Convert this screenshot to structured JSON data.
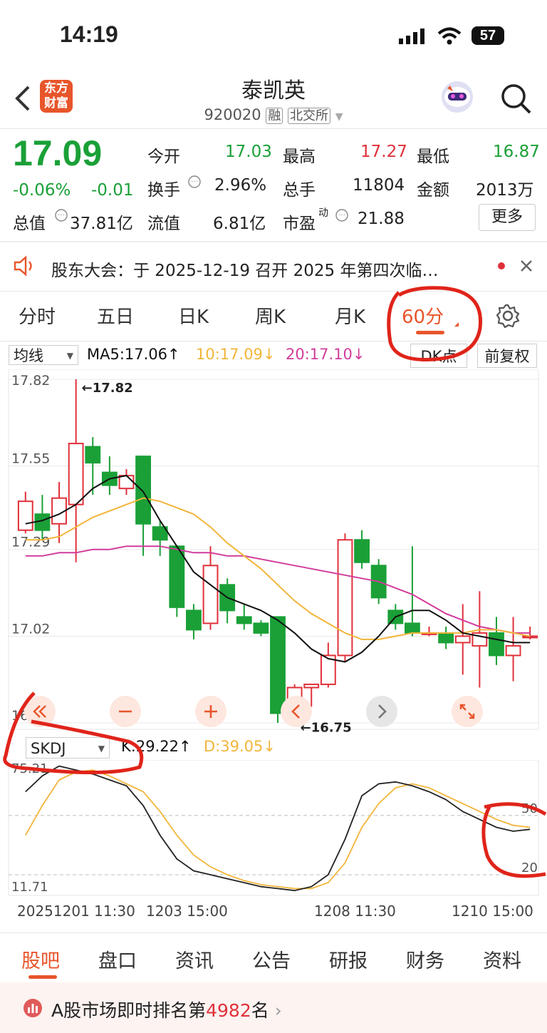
{
  "status_bar": {
    "time": "14:19",
    "battery": "57"
  },
  "header": {
    "back_icon": "chevron-left-icon",
    "logo_text_line1": "东方",
    "logo_text_line2": "财富",
    "title": "泰凯英",
    "code": "920020",
    "tag_margin": "融",
    "tag_exchange": "北交所",
    "search_icon": "search-icon"
  },
  "quote": {
    "price": "17.09",
    "change_pct": "-0.06%",
    "change": "-0.01",
    "market_cap_label": "总值",
    "market_cap": "37.81亿",
    "rows": [
      [
        {
          "label": "今开",
          "value": "17.03",
          "color": "green"
        },
        {
          "label": "最高",
          "value": "17.27",
          "color": "red"
        },
        {
          "label": "最低",
          "value": "16.87",
          "color": "green"
        }
      ],
      [
        {
          "label": "换手",
          "value": "2.96%",
          "color": "black"
        },
        {
          "label": "总手",
          "value": "11804",
          "color": "black"
        },
        {
          "label": "金额",
          "value": "2013万",
          "color": "black"
        }
      ],
      [
        {
          "label": "流值",
          "value": "6.81亿",
          "color": "black"
        },
        {
          "label": "市盈",
          "value": "21.88",
          "color": "black"
        }
      ]
    ],
    "pe_sup": "动",
    "more_button": "更多"
  },
  "notice": {
    "text": "股东大会：于 2025-12-19 召开 2025 年第四次临…"
  },
  "period_tabs": [
    "分时",
    "五日",
    "日K",
    "周K",
    "月K",
    "60分"
  ],
  "active_period": "60分",
  "chart_toolbar": {
    "indicator_select": "均线",
    "ma5": "MA5:17.06↑",
    "ma10": "10:17.09↓",
    "ma20": "20:17.10↓",
    "dk_button": "DK点",
    "adjust_button": "前复权"
  },
  "chart_data": {
    "type": "candlestick",
    "y_ticks": [
      "17.82",
      "17.55",
      "17.29",
      "17.02",
      "16.75"
    ],
    "ylim": [
      16.75,
      17.82
    ],
    "high_label": "←17.82",
    "low_label": "←16.75",
    "candles": [
      {
        "o": 17.35,
        "c": 17.44,
        "h": 17.47,
        "l": 17.34
      },
      {
        "o": 17.4,
        "c": 17.35,
        "h": 17.46,
        "l": 17.32
      },
      {
        "o": 17.37,
        "c": 17.45,
        "h": 17.5,
        "l": 17.31
      },
      {
        "o": 17.43,
        "c": 17.62,
        "h": 17.82,
        "l": 17.25
      },
      {
        "o": 17.61,
        "c": 17.56,
        "h": 17.64,
        "l": 17.46
      },
      {
        "o": 17.53,
        "c": 17.49,
        "h": 17.58,
        "l": 17.46
      },
      {
        "o": 17.48,
        "c": 17.52,
        "h": 17.54,
        "l": 17.46
      },
      {
        "o": 17.58,
        "c": 17.37,
        "h": 17.58,
        "l": 17.27
      },
      {
        "o": 17.36,
        "c": 17.32,
        "h": 17.38,
        "l": 17.27
      },
      {
        "o": 17.3,
        "c": 17.11,
        "h": 17.3,
        "l": 17.08
      },
      {
        "o": 17.1,
        "c": 17.04,
        "h": 17.12,
        "l": 17.01
      },
      {
        "o": 17.06,
        "c": 17.24,
        "h": 17.3,
        "l": 17.04
      },
      {
        "o": 17.18,
        "c": 17.1,
        "h": 17.2,
        "l": 17.06
      },
      {
        "o": 17.08,
        "c": 17.06,
        "h": 17.12,
        "l": 17.04
      },
      {
        "o": 17.06,
        "c": 17.03,
        "h": 17.07,
        "l": 17.02
      },
      {
        "o": 17.08,
        "c": 16.78,
        "h": 17.08,
        "l": 16.75
      },
      {
        "o": 16.79,
        "c": 16.86,
        "h": 16.87,
        "l": 16.74
      },
      {
        "o": 16.86,
        "c": 16.87,
        "h": 16.87,
        "l": 16.8
      },
      {
        "o": 16.87,
        "c": 16.96,
        "h": 17.0,
        "l": 16.86
      },
      {
        "o": 16.96,
        "c": 17.32,
        "h": 17.34,
        "l": 16.94
      },
      {
        "o": 17.32,
        "c": 17.25,
        "h": 17.35,
        "l": 17.23
      },
      {
        "o": 17.24,
        "c": 17.14,
        "h": 17.26,
        "l": 17.12
      },
      {
        "o": 17.1,
        "c": 17.06,
        "h": 17.12,
        "l": 17.04
      },
      {
        "o": 17.06,
        "c": 17.03,
        "h": 17.3,
        "l": 17.02
      },
      {
        "o": 17.03,
        "c": 17.03,
        "h": 17.05,
        "l": 17.02
      },
      {
        "o": 17.03,
        "c": 17.0,
        "h": 17.05,
        "l": 16.98
      },
      {
        "o": 17.0,
        "c": 17.02,
        "h": 17.12,
        "l": 16.9
      },
      {
        "o": 16.99,
        "c": 17.03,
        "h": 17.16,
        "l": 16.86
      },
      {
        "o": 17.03,
        "c": 16.96,
        "h": 17.08,
        "l": 16.93
      },
      {
        "o": 16.96,
        "c": 16.99,
        "h": 17.08,
        "l": 16.88
      },
      {
        "o": 17.02,
        "c": 17.02,
        "h": 17.05,
        "l": 17.01
      }
    ],
    "ma5": [
      17.37,
      17.38,
      17.4,
      17.43,
      17.48,
      17.51,
      17.52,
      17.47,
      17.38,
      17.3,
      17.22,
      17.18,
      17.14,
      17.12,
      17.1,
      17.07,
      17.03,
      16.98,
      16.95,
      16.94,
      16.97,
      17.02,
      17.08,
      17.1,
      17.1,
      17.07,
      17.03,
      17.02,
      17.01,
      17.0,
      17.0
    ],
    "ma10": [
      17.32,
      17.32,
      17.33,
      17.36,
      17.39,
      17.41,
      17.43,
      17.45,
      17.44,
      17.42,
      17.4,
      17.36,
      17.31,
      17.27,
      17.23,
      17.18,
      17.13,
      17.09,
      17.06,
      17.03,
      17.01,
      17.01,
      17.02,
      17.03,
      17.03,
      17.03,
      17.03,
      17.04,
      17.04,
      17.03,
      17.02
    ],
    "ma20": [
      17.27,
      17.27,
      17.28,
      17.28,
      17.29,
      17.29,
      17.3,
      17.3,
      17.3,
      17.29,
      17.28,
      17.28,
      17.27,
      17.27,
      17.26,
      17.25,
      17.24,
      17.23,
      17.22,
      17.21,
      17.2,
      17.19,
      17.17,
      17.15,
      17.12,
      17.09,
      17.07,
      17.05,
      17.04,
      17.03,
      17.03
    ]
  },
  "chart_controls": [
    "prev-page-icon",
    "zoom-out-icon",
    "zoom-in-icon",
    "prev-icon",
    "next-icon",
    "fullscreen-icon"
  ],
  "sub_chart": {
    "indicator_select": "SKDJ",
    "k_label": "K:29.22↑",
    "d_label": "D:39.05↓",
    "top_tick": "75.21",
    "bottom_tick": "11.71",
    "level_50": "50",
    "level_20": "20",
    "ylim": [
      11.71,
      75.21
    ],
    "k": [
      62,
      70,
      75,
      73,
      71,
      68,
      65,
      55,
      40,
      28,
      22,
      20,
      18,
      16,
      14,
      13,
      12,
      14,
      20,
      38,
      60,
      66,
      67,
      65,
      62,
      58,
      52,
      48,
      44,
      42,
      43
    ],
    "d": [
      40,
      55,
      68,
      72,
      73,
      70,
      66,
      62,
      52,
      40,
      30,
      24,
      20,
      17,
      15,
      14,
      13,
      13,
      16,
      26,
      44,
      56,
      64,
      66,
      64,
      60,
      56,
      52,
      48,
      45,
      44
    ]
  },
  "x_axis_labels": [
    "20251201 11:30",
    "1203 15:00",
    "1208 11:30",
    "1210 15:00"
  ],
  "bottom_nav": [
    "股吧",
    "盘口",
    "资讯",
    "公告",
    "研报",
    "财务",
    "资料"
  ],
  "active_nav": "股吧",
  "banner": {
    "prefix": "A股市场即时排名第",
    "rank": "4982",
    "suffix": "名"
  },
  "colors": {
    "up": "#e0313a",
    "down": "#1aa037",
    "accent": "#e8552b",
    "ma5": "#111111",
    "ma10": "#f2b53a",
    "ma20": "#d23c9b",
    "annotation": "#e0241a"
  }
}
